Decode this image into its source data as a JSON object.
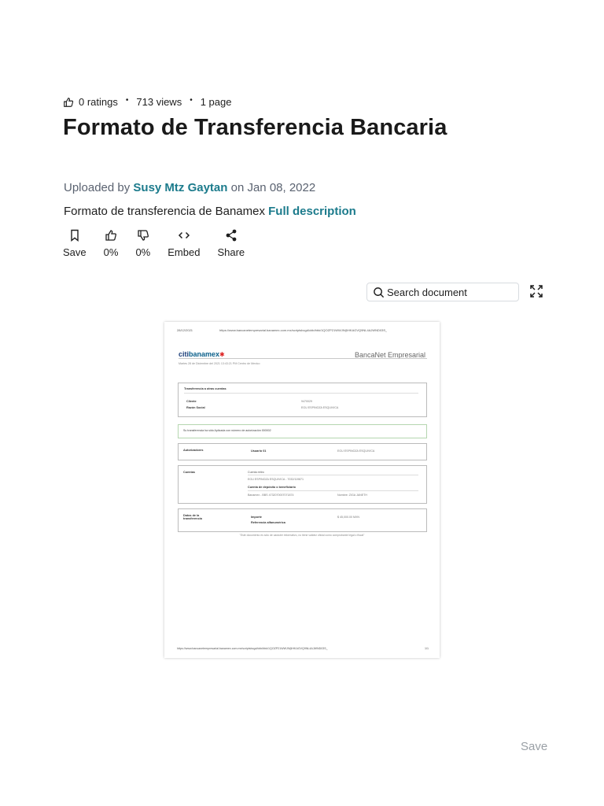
{
  "meta": {
    "ratings": "0 ratings",
    "views": "713 views",
    "pages": "1 page",
    "separator": "•"
  },
  "title": "Formato de Transferencia Bancaria",
  "upload": {
    "prefix": "Uploaded by",
    "author": "Susy Mtz Gaytan",
    "date_text": "on Jan 08, 2022"
  },
  "description": {
    "text": "Formato de transferencia de Banamex",
    "link": "Full description"
  },
  "actions": {
    "save": "Save",
    "upvote_pct": "0%",
    "downvote_pct": "0%",
    "embed": "Embed",
    "share": "Share"
  },
  "search": {
    "placeholder": "Search document"
  },
  "document": {
    "header_date": "28/12/2021",
    "header_url": "https://www.bancanetempresarial.banamex.com.mx/scriptsbcgd/cbb/bbk/1QOZP21WWJ9@HKAGVQ9NL4AJWND03S_",
    "logo_citi": "citi",
    "logo_bank": "banamex",
    "logo_star": "✱",
    "banca": "BancaNet Empresarial",
    "date_line": "Martes 28 de Diciembre del 2021 13:43:21 PM Centro de Mexico",
    "box1_title": "Transferencia a otras cuentas",
    "cliente_label": "Cliente",
    "cliente_value": "9470029",
    "razon_label": "Razón Social",
    "razon_value": "EGU ESPINOZA ESQUIVICA",
    "status": "Su transferencia ha sido Aplicada con número de autorización 000002",
    "autorizadores_label": "Autorizadores",
    "usuario_label": "Usuario 01",
    "usuario_value": "EGU ESPINOZA ESQUIVICA",
    "cuentas_label": "Cuentas",
    "cuenta_retiro": "Cuenta retiro",
    "cuenta_retiro_value": "EGU ESPINOZA ESQUIVICA - 7032/119871",
    "cuenta_deposito": "Cuenta de depósito o beneficiario",
    "cuenta_deposito_value": "Banamex - BBS 4732070007071874",
    "cuenta_deposito_extra": "Nombre: ZIGA JANETH",
    "datos_label": "Datos de la transferencia",
    "importe_label": "Importe",
    "importe_value": "$ 45,000.00 MXN",
    "referencia_label": "Referencia alfanumérica",
    "note": "\"Este documento es sólo de carácter informativo, no tiene validez oficial como comprobante legal o fiscal\"",
    "footer_url": "https://www.bancanetempresarial.banamex.com.mx/scriptsbcgd/cbb/bbk/1QOZP21WWJ9@HKAGVQ9NL4AJWND03S_",
    "footer_page": "1/1"
  },
  "bottom_save": "Save",
  "colors": {
    "link": "#1c7b8c",
    "muted": "#5a6270",
    "text": "#1e1e1e"
  },
  "icons": [
    "thumbs-up-icon",
    "bookmark-icon",
    "thumbs-down-icon",
    "code-icon",
    "share-icon",
    "search-icon",
    "expand-icon"
  ]
}
